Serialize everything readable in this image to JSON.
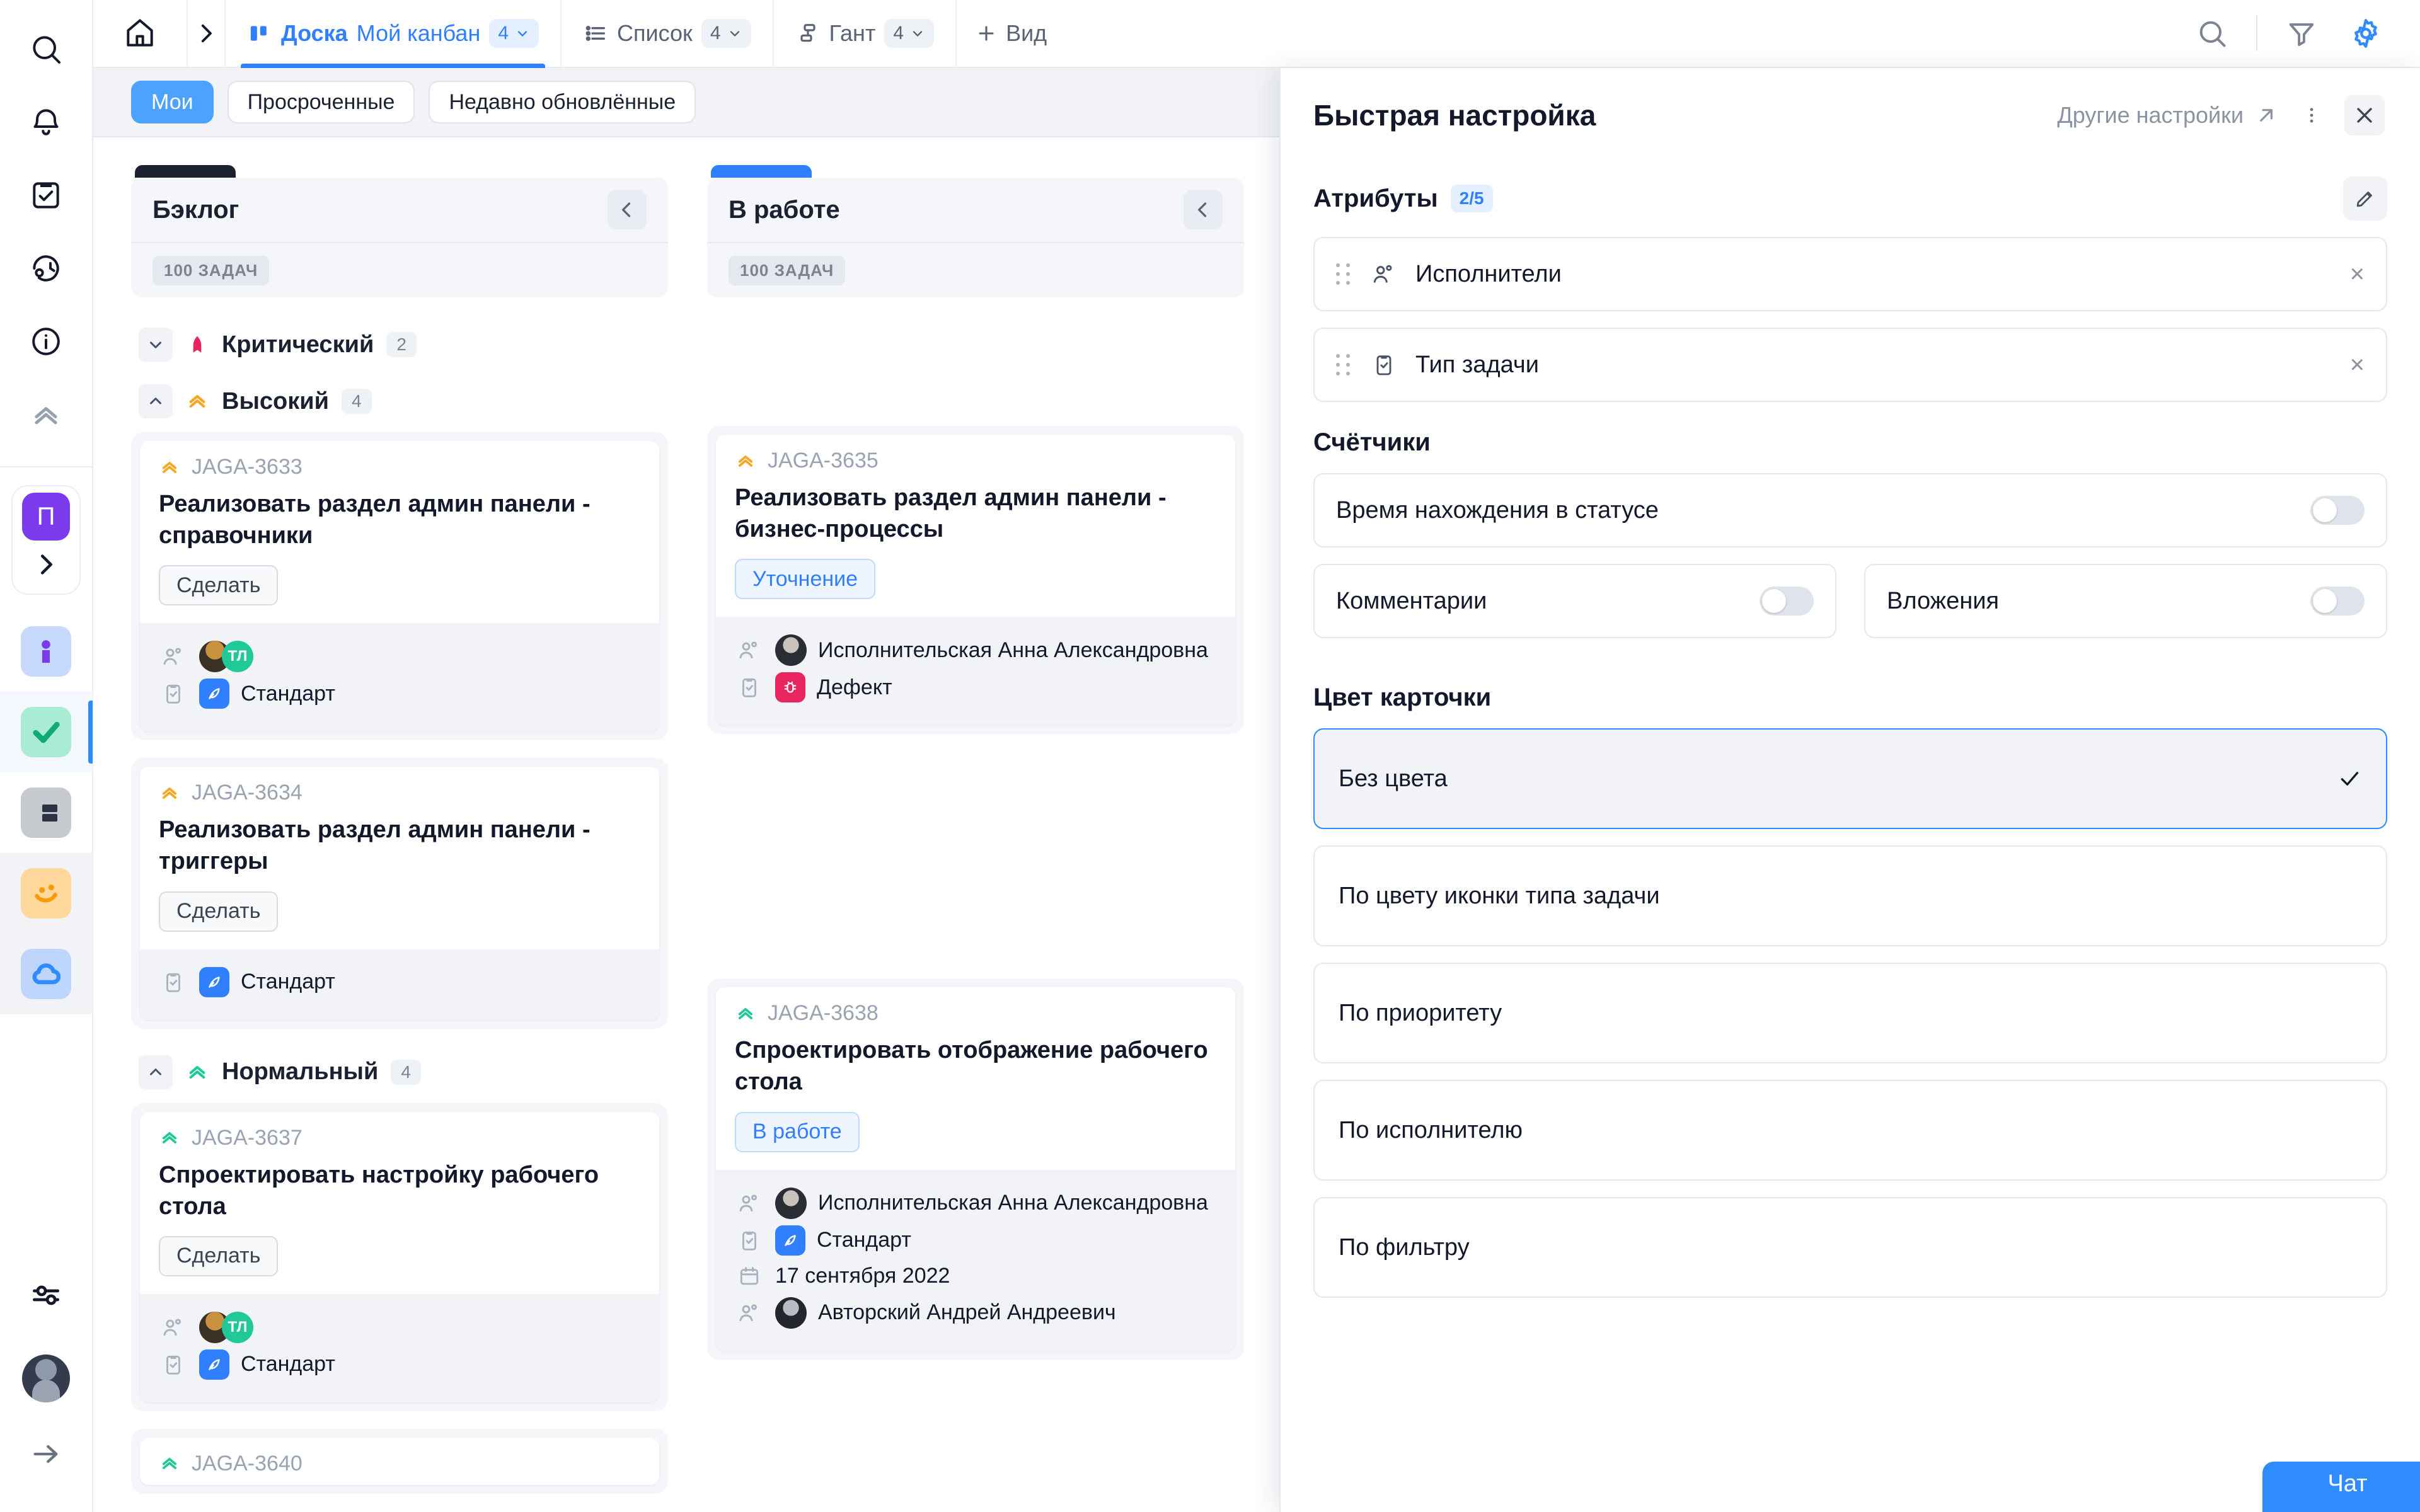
{
  "rail": {
    "top_icons": [
      {
        "name": "home-icon",
        "label": "Главная"
      },
      {
        "name": "search-icon",
        "label": "Поиск"
      },
      {
        "name": "bell-icon",
        "label": "Уведомления"
      },
      {
        "name": "tasks-icon",
        "label": "Задачи"
      },
      {
        "name": "worklog-icon",
        "label": "Трудозатраты"
      },
      {
        "name": "info-icon",
        "label": "Информация"
      },
      {
        "name": "priority-icon",
        "label": "Приоритет"
      }
    ],
    "project_badge": "П",
    "apps": [
      {
        "name": "app-info",
        "label": "Инфо"
      },
      {
        "name": "app-tasks",
        "label": "Задачи",
        "active": true
      },
      {
        "name": "app-boards",
        "label": "Доски"
      },
      {
        "name": "app-smile",
        "label": "Сообщество"
      },
      {
        "name": "app-cloud",
        "label": "Облако"
      }
    ],
    "bottom_icons": [
      {
        "name": "sliders-icon",
        "label": "Настройки"
      },
      {
        "name": "user-avatar",
        "label": "Профиль"
      },
      {
        "name": "arrow-right-icon",
        "label": "Выход"
      }
    ]
  },
  "topbar": {
    "tabs": [
      {
        "name": "tab-board",
        "icon": "board-icon",
        "label": "Доска",
        "sub": "Мой канбан",
        "count": "4",
        "active": true
      },
      {
        "name": "tab-list",
        "icon": "list-icon",
        "label": "Список",
        "sub": "",
        "count": "4",
        "active": false
      },
      {
        "name": "tab-gantt",
        "icon": "gantt-icon",
        "label": "Гант",
        "sub": "",
        "count": "4",
        "active": false
      }
    ],
    "add_view_label": "Вид",
    "actions": [
      {
        "name": "search-icon",
        "label": "Поиск"
      },
      {
        "name": "filter-icon",
        "label": "Фильтр"
      },
      {
        "name": "gear-icon",
        "label": "Настройки",
        "color": "#2f8bff"
      }
    ]
  },
  "chipbar": {
    "chips": [
      {
        "name": "chip-my",
        "label": "Мои",
        "active": true
      },
      {
        "name": "chip-overdue",
        "label": "Просроченные",
        "active": false
      },
      {
        "name": "chip-recent",
        "label": "Недавно обновлённые",
        "active": false
      }
    ]
  },
  "board": {
    "columns": [
      {
        "name": "column-backlog",
        "title": "Бэклог",
        "count_label": "100 ЗАДАЧ",
        "accent": "#1b2131",
        "groups": [
          {
            "name": "group-critical",
            "label": "Критический",
            "count": "2",
            "icon": "priority-critical-icon",
            "color": "#e8255f",
            "expanded": false,
            "cards": []
          },
          {
            "name": "group-high",
            "label": "Высокий",
            "count": "4",
            "icon": "priority-high-icon",
            "color": "#f7a823",
            "expanded": true,
            "cards": [
              {
                "key": "JAGA-3633",
                "priority_color": "#f7a823",
                "title": "Реализовать раздел админ панели - справочники",
                "status": "Сделать",
                "status_style": "grey",
                "assignees": [
                  {
                    "type": "photo",
                    "style": "a"
                  },
                  {
                    "type": "initials",
                    "text": "ТЛ"
                  }
                ],
                "type_label": "Стандарт",
                "type_badge": "standard",
                "date": "",
                "author": ""
              },
              {
                "key": "JAGA-3634",
                "priority_color": "#f7a823",
                "title": "Реализовать раздел админ панели - триггеры",
                "status": "Сделать",
                "status_style": "grey",
                "assignees": [],
                "type_label": "Стандарт",
                "type_badge": "standard",
                "date": "",
                "author": ""
              }
            ]
          },
          {
            "name": "group-normal",
            "label": "Нормальный",
            "count": "4",
            "icon": "priority-normal-icon",
            "color": "#21c999",
            "expanded": true,
            "cards": [
              {
                "key": "JAGA-3637",
                "priority_color": "#21c999",
                "title": "Спроектировать настройку рабочего стола",
                "status": "Сделать",
                "status_style": "grey",
                "assignees": [
                  {
                    "type": "photo",
                    "style": "a"
                  },
                  {
                    "type": "initials",
                    "text": "ТЛ"
                  }
                ],
                "type_label": "Стандарт",
                "type_badge": "standard",
                "date": "",
                "author": ""
              },
              {
                "key": "JAGA-3640",
                "priority_color": "#21c999",
                "title": "",
                "status": "",
                "status_style": "grey",
                "assignees": [],
                "type_label": "",
                "type_badge": "",
                "date": "",
                "author": ""
              }
            ]
          }
        ]
      },
      {
        "name": "column-inprogress",
        "title": "В работе",
        "count_label": "100 ЗАДАЧ",
        "accent": "#2f7fff",
        "groups": [
          {
            "name": "group-high-wip",
            "label": "",
            "count": "",
            "icon": "",
            "color": "#f7a823",
            "expanded": true,
            "cards": [
              {
                "key": "JAGA-3635",
                "priority_color": "#f7a823",
                "title": "Реализовать раздел админ панели - бизнес-процессы",
                "status": "Уточнение",
                "status_style": "blue",
                "assignees": [
                  {
                    "type": "photo",
                    "style": "b",
                    "name": "Исполнительская Анна Александровна"
                  }
                ],
                "type_label": "Дефект",
                "type_badge": "bug",
                "date": "",
                "author": ""
              }
            ]
          },
          {
            "name": "group-normal-wip",
            "label": "",
            "count": "",
            "icon": "",
            "color": "#21c999",
            "expanded": true,
            "cards": [
              {
                "key": "JAGA-3638",
                "priority_color": "#21c999",
                "title": "Спроектировать отображение рабочего стола",
                "status": "В работе",
                "status_style": "blue",
                "assignees": [
                  {
                    "type": "photo",
                    "style": "b",
                    "name": "Исполнительская Анна Александровна"
                  }
                ],
                "type_label": "Стандарт",
                "type_badge": "standard",
                "date": "17 сентября 2022",
                "author": "Авторский Андрей Андреевич"
              }
            ]
          }
        ]
      }
    ]
  },
  "panel": {
    "title": "Быстрая настройка",
    "other_settings_label": "Другие настройки",
    "attributes": {
      "section_title": "Атрибуты",
      "badge": "2/5",
      "items": [
        {
          "name": "attr-assignees",
          "label": "Исполнители",
          "icon": "people-icon"
        },
        {
          "name": "attr-task-type",
          "label": "Тип задачи",
          "icon": "clipboard-check-icon"
        }
      ]
    },
    "counters": {
      "section_title": "Счётчики",
      "items": [
        {
          "name": "counter-status-time",
          "label": "Время нахождения в статусе",
          "on": false,
          "full_width": true
        },
        {
          "name": "counter-comments",
          "label": "Комментарии",
          "on": false,
          "full_width": false
        },
        {
          "name": "counter-attachments",
          "label": "Вложения",
          "on": false,
          "full_width": false
        }
      ]
    },
    "card_color": {
      "section_title": "Цвет карточки",
      "options": [
        {
          "name": "color-none",
          "label": "Без цвета",
          "selected": true
        },
        {
          "name": "color-by-type-icon",
          "label": "По цвету иконки типа задачи",
          "selected": false
        },
        {
          "name": "color-by-priority",
          "label": "По приоритету",
          "selected": false
        },
        {
          "name": "color-by-assignee",
          "label": "По исполнителю",
          "selected": false
        },
        {
          "name": "color-by-filter",
          "label": "По фильтру",
          "selected": false
        }
      ]
    }
  },
  "chat": {
    "label": "Чат"
  },
  "colors": {
    "accent_blue": "#2f8bff",
    "tab_blue": "#2f7fff",
    "critical": "#e8255f",
    "high": "#f7a823",
    "normal": "#21c999",
    "purple": "#7c3aed"
  }
}
